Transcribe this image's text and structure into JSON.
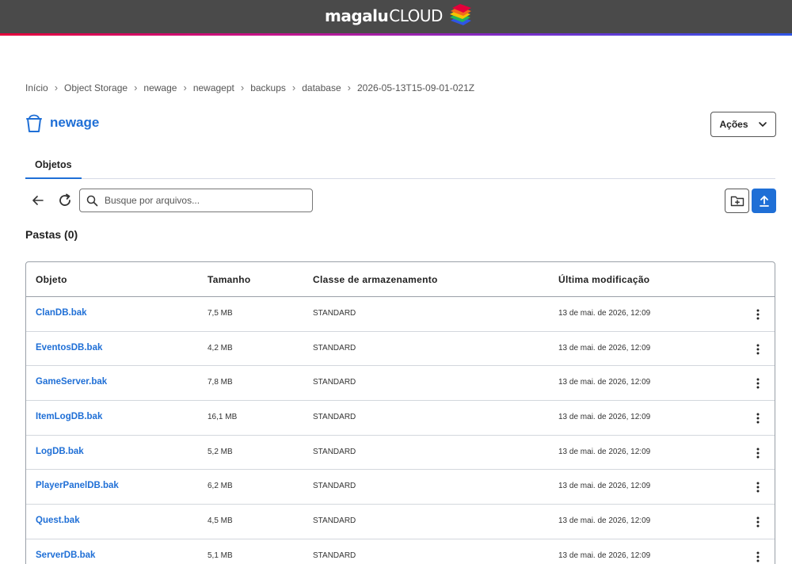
{
  "header": {
    "brand_main": "magalu",
    "brand_suffix": "CLOUD",
    "logo_icon": "magalu-stack-logo-icon"
  },
  "breadcrumb": [
    "Início",
    "Object Storage",
    "newage",
    "newagept",
    "backups",
    "database",
    "2026-05-13T15-09-01-021Z"
  ],
  "page": {
    "title": "newage",
    "title_icon": "bucket-icon",
    "actions_label": "Ações"
  },
  "tabs": [
    {
      "label": "Objetos",
      "active": true
    }
  ],
  "toolbar": {
    "search_placeholder": "Busque por arquivos...",
    "search_value": ""
  },
  "folders_title": "Pastas (0)",
  "table": {
    "headers": [
      "Objeto",
      "Tamanho",
      "Classe de armazenamento",
      "Última modificação"
    ],
    "rows": [
      {
        "name": "ClanDB.bak",
        "size": "7,5 MB",
        "class": "STANDARD",
        "modified": "13 de mai. de 2026, 12:09"
      },
      {
        "name": "EventosDB.bak",
        "size": "4,2 MB",
        "class": "STANDARD",
        "modified": "13 de mai. de 2026, 12:09"
      },
      {
        "name": "GameServer.bak",
        "size": "7,8 MB",
        "class": "STANDARD",
        "modified": "13 de mai. de 2026, 12:09"
      },
      {
        "name": "ItemLogDB.bak",
        "size": "16,1 MB",
        "class": "STANDARD",
        "modified": "13 de mai. de 2026, 12:09"
      },
      {
        "name": "LogDB.bak",
        "size": "5,2 MB",
        "class": "STANDARD",
        "modified": "13 de mai. de 2026, 12:09"
      },
      {
        "name": "PlayerPanelDB.bak",
        "size": "6,2 MB",
        "class": "STANDARD",
        "modified": "13 de mai. de 2026, 12:09"
      },
      {
        "name": "Quest.bak",
        "size": "4,5 MB",
        "class": "STANDARD",
        "modified": "13 de mai. de 2026, 12:09"
      },
      {
        "name": "ServerDB.bak",
        "size": "5,1 MB",
        "class": "STANDARD",
        "modified": "13 de mai. de 2026, 12:09"
      }
    ]
  },
  "colors": {
    "accent": "#1f6fd6",
    "header_bg": "#4a4a4a"
  }
}
